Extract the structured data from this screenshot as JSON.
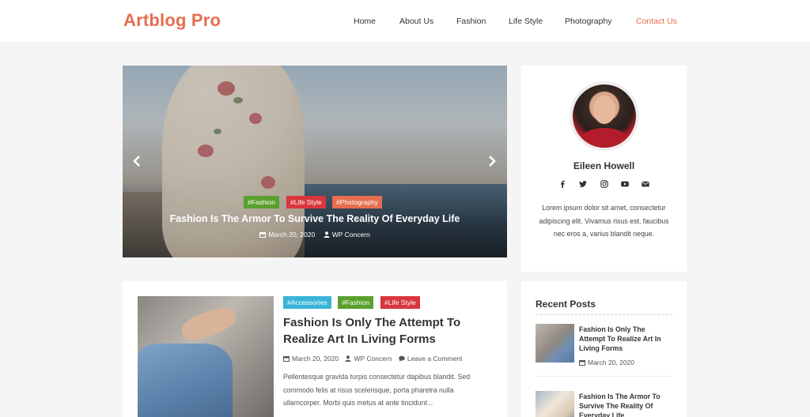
{
  "site": {
    "logo": "Artblog Pro"
  },
  "nav": {
    "items": [
      {
        "label": "Home"
      },
      {
        "label": "About Us"
      },
      {
        "label": "Fashion"
      },
      {
        "label": "Life Style"
      },
      {
        "label": "Photography"
      },
      {
        "label": "Contact Us",
        "active": true
      }
    ],
    "active_color": "#e56e4e"
  },
  "slider": {
    "tags": [
      {
        "label": "#Fashion",
        "color": "#5aa02c"
      },
      {
        "label": "#Life Style",
        "color": "#d9363e"
      },
      {
        "label": "#Photography",
        "color": "#e56e4e"
      }
    ],
    "title": "Fashion Is The Armor To Survive The Reality Of Everyday Life",
    "date": "March 20, 2020",
    "author": "WP Concern",
    "prev_icon": "chevron-left-icon",
    "next_icon": "chevron-right-icon"
  },
  "profile": {
    "name": "Eileen Howell",
    "bio": "Lorem ipsum dolor sit amet, consectetur adipiscing elit. Vivamus risus est, faucibus nec eros a, varius blandit neque.",
    "socials": [
      "facebook-icon",
      "twitter-icon",
      "instagram-icon",
      "youtube-icon",
      "mail-icon"
    ]
  },
  "post": {
    "tags": [
      {
        "label": "#Accessories",
        "color": "#3ab4d8"
      },
      {
        "label": "#Fashion",
        "color": "#5aa02c"
      },
      {
        "label": "#Life Style",
        "color": "#d9363e"
      }
    ],
    "title": "Fashion Is Only The Attempt To Realize Art In Living Forms",
    "date": "March 20, 2020",
    "author": "WP Concern",
    "comments": "Leave a Comment",
    "excerpt": "Pellentesque gravida turpis consectetur dapibus blandit. Sed commodo felis at risus scelerisque, porta pharetra nulla ullamcorper. Morbi quis metus at ante tincidunt..."
  },
  "recent": {
    "heading": "Recent Posts",
    "items": [
      {
        "title": "Fashion Is Only The Attempt To Realize Art In Living Forms",
        "date": "March 20, 2020"
      },
      {
        "title": "Fashion Is The Armor To Survive The Reality Of Everyday Life",
        "date": ""
      }
    ]
  }
}
